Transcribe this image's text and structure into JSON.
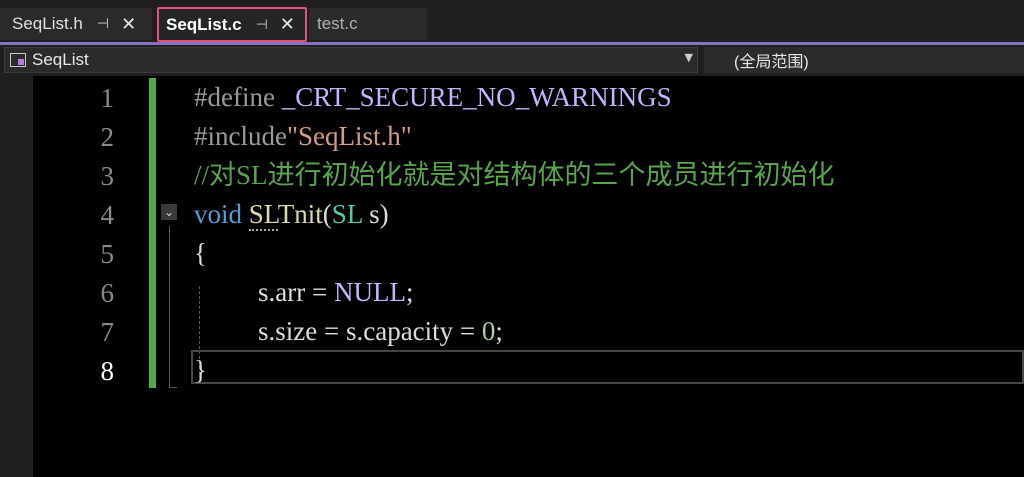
{
  "tabs": [
    {
      "label": "SeqList.h",
      "pin": "⊣",
      "close": "✕"
    },
    {
      "label": "SeqList.c",
      "pin": "⊣",
      "close": "✕"
    },
    {
      "label": "test.c"
    }
  ],
  "navbar": {
    "scope_label": "SeqList",
    "dropdown": "▼",
    "right_label": "(全局范围)"
  },
  "line_numbers": [
    "1",
    "2",
    "3",
    "4",
    "5",
    "6",
    "7",
    "8"
  ],
  "fold_glyph": "⌄",
  "code": {
    "l1_a": "#define",
    "l1_b": " _CRT_SECURE_NO_WARNINGS",
    "l2_a": "#include",
    "l2_b": "\"SeqList.h\"",
    "l3": "//对SL进行初始化就是对结构体的三个成员进行初始化",
    "l4_kw": "void",
    "l4_fn_a": "SL",
    "l4_fn_b": "Tnit",
    "l4_p1": "(",
    "l4_ty": "SL",
    "l4_id": " s",
    "l4_p2": ")",
    "l5": "{",
    "l6_id": "s.arr",
    "l6_op": " = ",
    "l6_mac": "NULL",
    "l6_semi": ";",
    "l7_id1": "s.size",
    "l7_op1": " = ",
    "l7_id2": "s.capacity",
    "l7_op2": " = ",
    "l7_num": "0",
    "l7_semi": ";",
    "l8": "}"
  }
}
